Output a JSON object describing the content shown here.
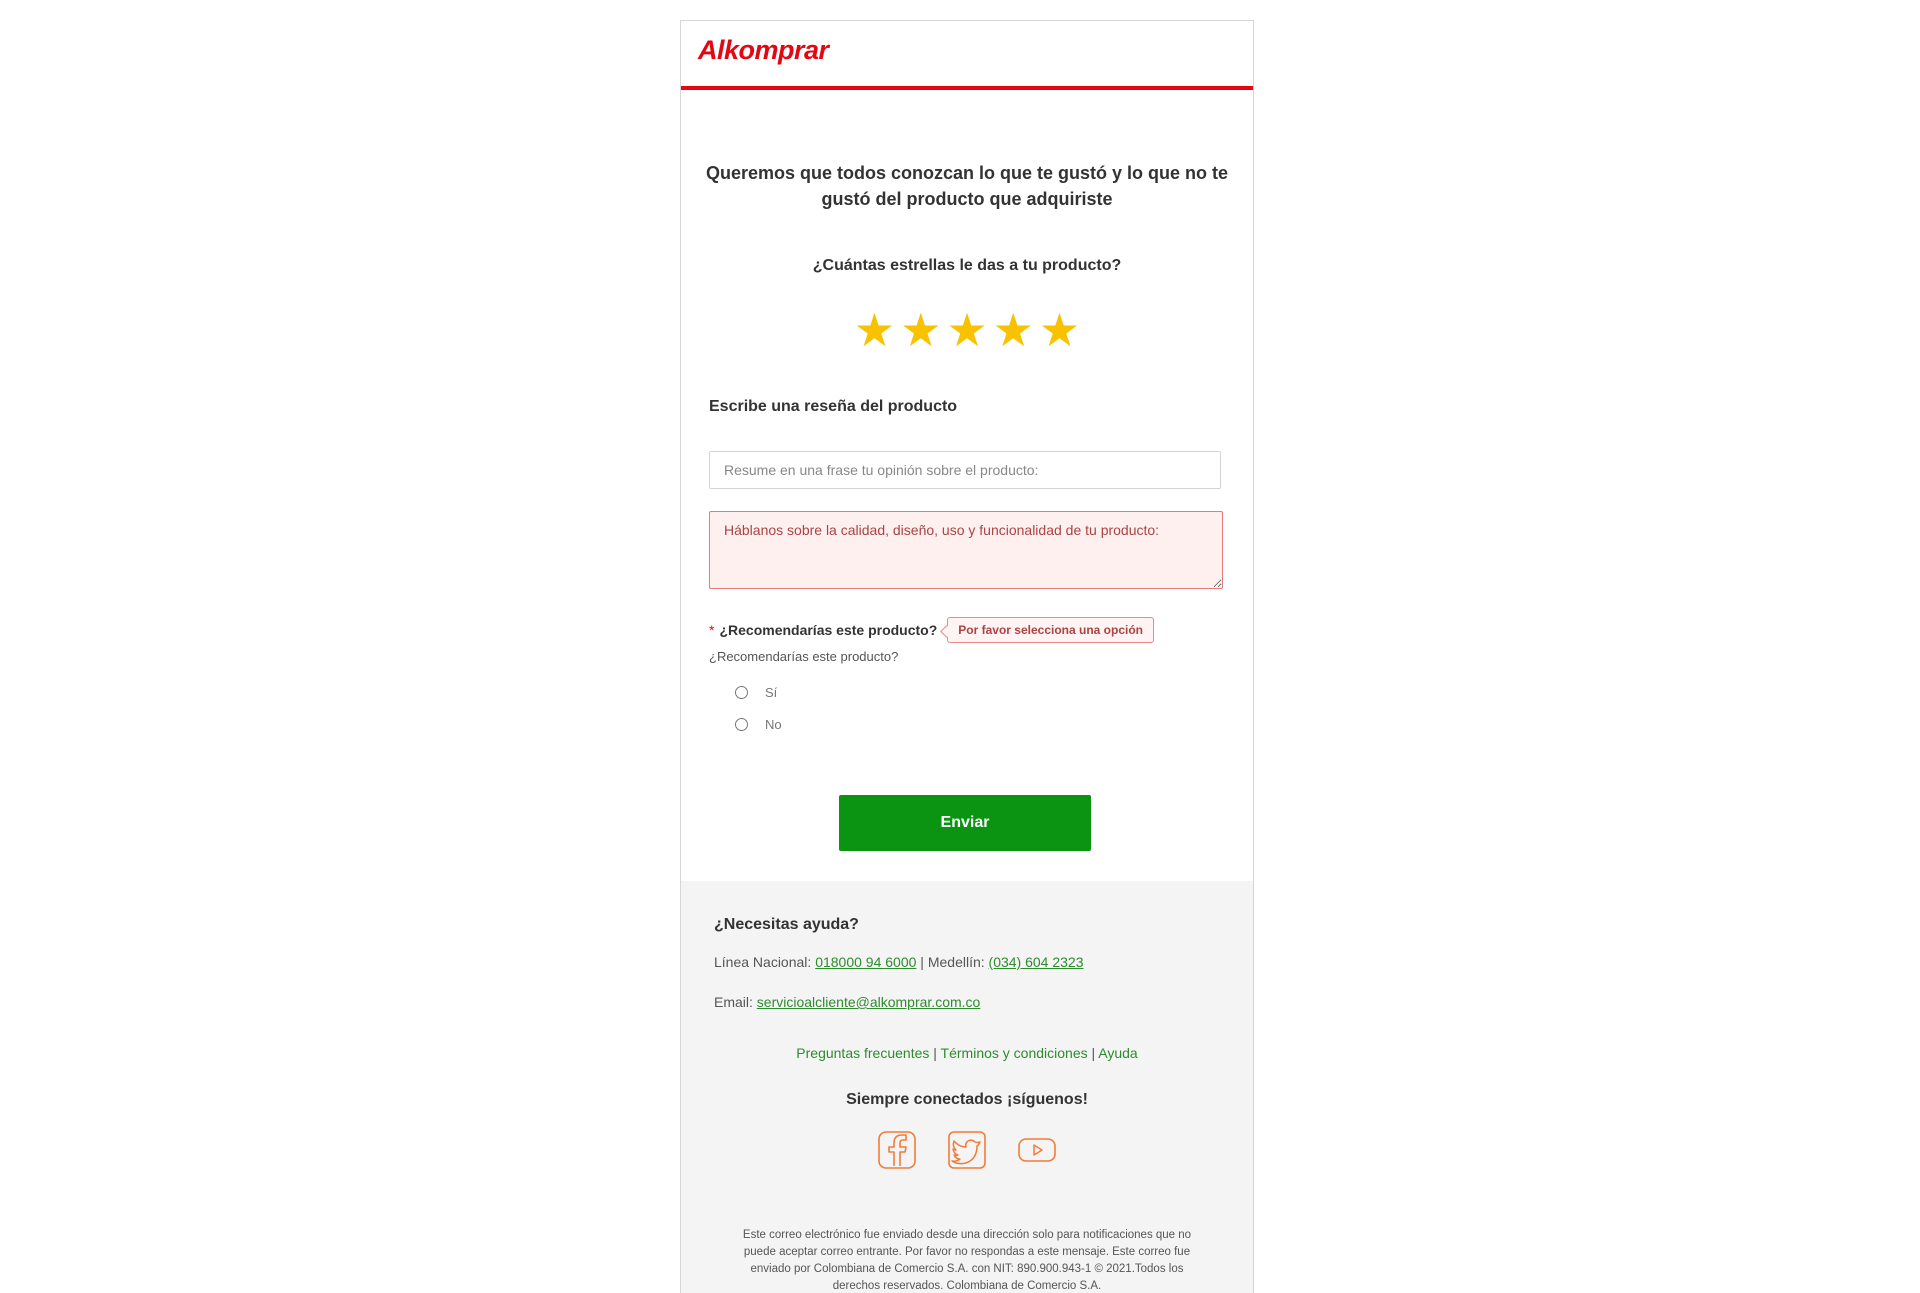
{
  "brand": {
    "logo_text": "Alkomprar",
    "accent_color": "#e30613"
  },
  "form": {
    "title": "Queremos que todos conozcan lo que te gustó y lo que no te gustó del producto que adquiriste",
    "stars_question": "¿Cuántas estrellas le das a tu producto?",
    "rating": {
      "value": 5,
      "max": 5,
      "star_glyph": "★",
      "star_color": "#f9c200"
    },
    "review_heading": "Escribe una reseña del producto",
    "summary_placeholder": "Resume en una frase tu opinión sobre el producto:",
    "detail_placeholder": "Háblanos sobre la calidad, diseño, uso y funcionalidad de tu producto:",
    "recommend": {
      "required_mark": "*",
      "label": "¿Recomendarías este producto?",
      "error_tooltip": "Por favor selecciona una opción",
      "sub_label": "¿Recomendarías este producto?",
      "options": [
        {
          "label": "Sí"
        },
        {
          "label": "No"
        }
      ]
    },
    "submit_label": "Enviar",
    "submit_color": "#0a9412"
  },
  "footer": {
    "help_title": "¿Necesitas ayuda?",
    "national_label": "Línea Nacional:",
    "national_phone": "018000 94 6000",
    "separator": "|",
    "medellin_label": "Medellín:",
    "medellin_phone": "(034) 604 2323",
    "email_label": "Email:",
    "email": "servicioalcliente@alkomprar.com.co",
    "links": [
      {
        "label": "Preguntas frecuentes"
      },
      {
        "label": "Términos y condiciones"
      },
      {
        "label": "Ayuda"
      }
    ],
    "follow": "Siempre conectados ¡síguenos!",
    "social": [
      {
        "icon": "facebook-icon"
      },
      {
        "icon": "twitter-icon"
      },
      {
        "icon": "youtube-icon"
      }
    ],
    "social_color": "#f07c3a",
    "legal": "Este correo electrónico fue enviado desde una dirección solo para notificaciones que no puede aceptar correo entrante. Por favor no respondas a este mensaje. Este correo fue enviado por Colombiana de Comercio S.A. con NIT: 890.900.943-1 © 2021.Todos los derechos reservados. Colombiana de Comercio S.A."
  }
}
